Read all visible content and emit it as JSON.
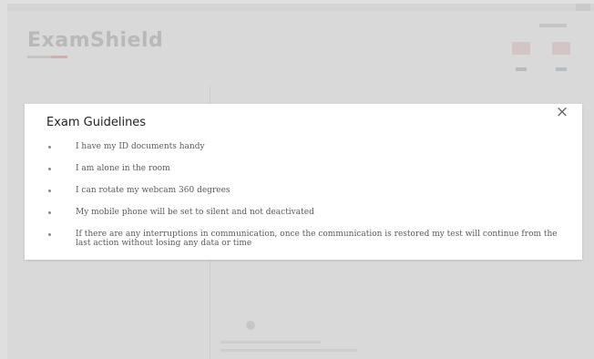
{
  "app": {
    "logo": "ExamShield"
  },
  "modal": {
    "title": "Exam Guidelines",
    "close_icon": "×",
    "items": [
      "I have my ID documents handy",
      "I am alone in the room",
      "I can rotate my webcam 360 degrees",
      "My mobile phone will be set to silent and not deactivated",
      "If there are any interruptions in communication, once the communication is restored my test will continue from the last action without losing any data or time"
    ]
  },
  "icons": {
    "close": "close-icon",
    "bullet": "bullet-icon"
  },
  "colors": {
    "modal_background": "#ffffff",
    "overlay": "#aaaaaa",
    "title": "#222222",
    "text": "#5a5a5a"
  }
}
